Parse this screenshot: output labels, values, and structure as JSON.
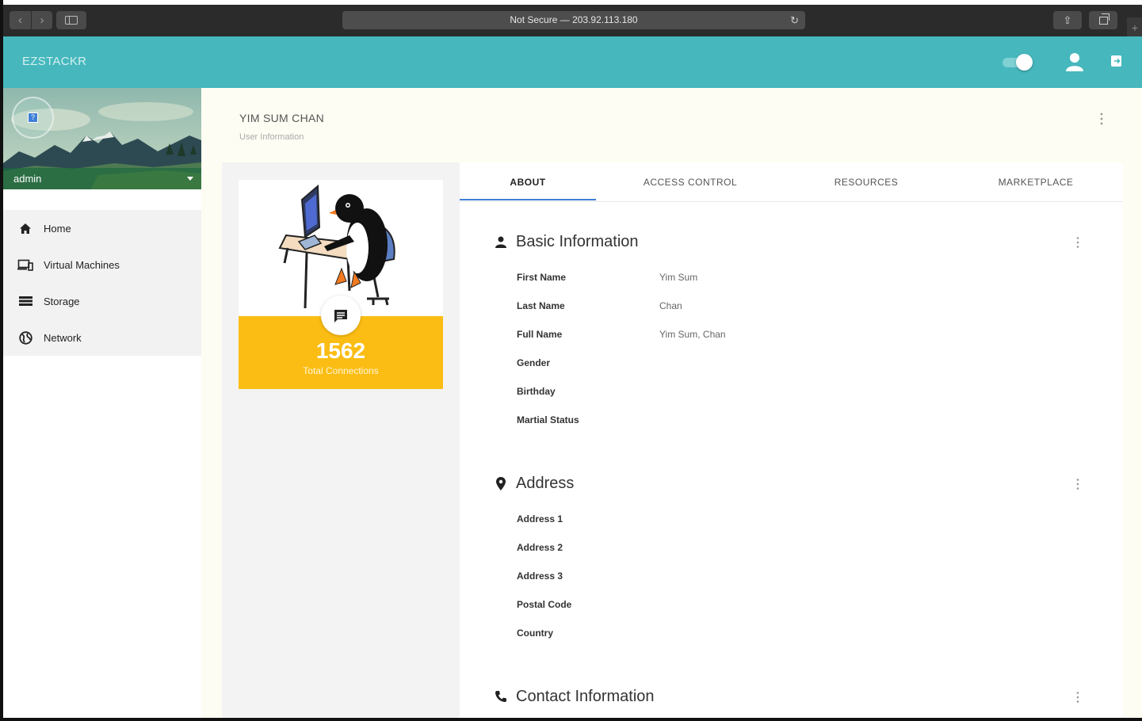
{
  "browser": {
    "address": "Not Secure — 203.92.113.180",
    "back_glyph": "‹",
    "forward_glyph": "›",
    "reload_glyph": "↻",
    "share_glyph": "⇪",
    "new_tab_glyph": "+"
  },
  "header": {
    "brand": "EZSTACKR",
    "color": "#46b8bd"
  },
  "sidebar": {
    "user": "admin",
    "avatar_glyph": "?",
    "items": [
      {
        "label": "Home",
        "icon": "home-icon"
      },
      {
        "label": "Virtual Machines",
        "icon": "devices-icon"
      },
      {
        "label": "Storage",
        "icon": "storage-list-icon"
      },
      {
        "label": "Network",
        "icon": "globe-icon"
      }
    ]
  },
  "page": {
    "title": "YIM SUM CHAN",
    "subtitle": "User Information"
  },
  "profile_card": {
    "stat_value": "1562",
    "stat_label": "Total Connections",
    "accent": "#fbbd13"
  },
  "tabs": [
    {
      "label": "ABOUT",
      "active": true
    },
    {
      "label": "ACCESS CONTROL",
      "active": false
    },
    {
      "label": "RESOURCES",
      "active": false
    },
    {
      "label": "MARKETPLACE",
      "active": false
    }
  ],
  "sections": {
    "basic": {
      "title": "Basic Information",
      "icon": "person-icon",
      "fields": [
        {
          "label": "First Name",
          "value": "Yim Sum"
        },
        {
          "label": "Last Name",
          "value": "Chan"
        },
        {
          "label": "Full Name",
          "value": "Yim Sum, Chan"
        },
        {
          "label": "Gender",
          "value": ""
        },
        {
          "label": "Birthday",
          "value": ""
        },
        {
          "label": "Martial Status",
          "value": ""
        }
      ]
    },
    "address": {
      "title": "Address",
      "icon": "location-pin-icon",
      "fields": [
        {
          "label": "Address 1",
          "value": ""
        },
        {
          "label": "Address 2",
          "value": ""
        },
        {
          "label": "Address 3",
          "value": ""
        },
        {
          "label": "Postal Code",
          "value": ""
        },
        {
          "label": "Country",
          "value": ""
        }
      ]
    },
    "contact": {
      "title": "Contact Information",
      "icon": "phone-icon"
    }
  }
}
